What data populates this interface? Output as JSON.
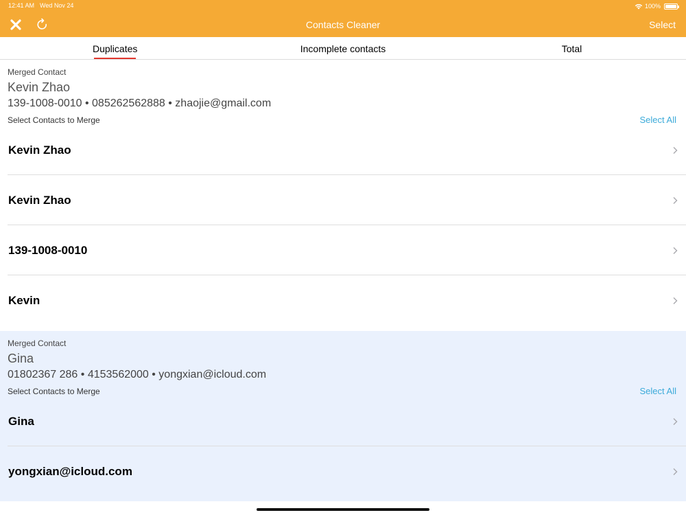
{
  "status_bar": {
    "time": "12:41 AM",
    "date": "Wed Nov 24",
    "battery": "100%"
  },
  "nav": {
    "title": "Contacts Cleaner",
    "select_label": "Select"
  },
  "tabs": [
    {
      "label": "Duplicates",
      "active": true
    },
    {
      "label": "Incomplete contacts",
      "active": false
    },
    {
      "label": "Total",
      "active": false
    }
  ],
  "groups": [
    {
      "merged_label": "Merged Contact",
      "name": "Kevin Zhao",
      "details": "139-1008-0010 • 085262562888 • zhaojie@gmail.com",
      "select_label": "Select Contacts to Merge",
      "select_all": "Select All",
      "rows": [
        {
          "label": "Kevin Zhao"
        },
        {
          "label": "Kevin Zhao"
        },
        {
          "label": "139-1008-0010"
        },
        {
          "label": "Kevin"
        }
      ]
    },
    {
      "merged_label": "Merged Contact",
      "name": "Gina",
      "details": "01802367 286 • 4153562000 • yongxian@icloud.com",
      "select_label": "Select Contacts to Merge",
      "select_all": "Select All",
      "rows": [
        {
          "label": "Gina"
        },
        {
          "label": "yongxian@icloud.com"
        }
      ]
    }
  ],
  "colors": {
    "header": "#F5AA35",
    "tab_indicator": "#E2372E",
    "link": "#3BAAD9",
    "group_highlight": "#EAF1FD"
  },
  "icons": {
    "close": "close-icon",
    "refresh": "refresh-icon",
    "wifi": "wifi-icon",
    "battery": "battery-icon",
    "chevron": "chevron-right-icon"
  }
}
